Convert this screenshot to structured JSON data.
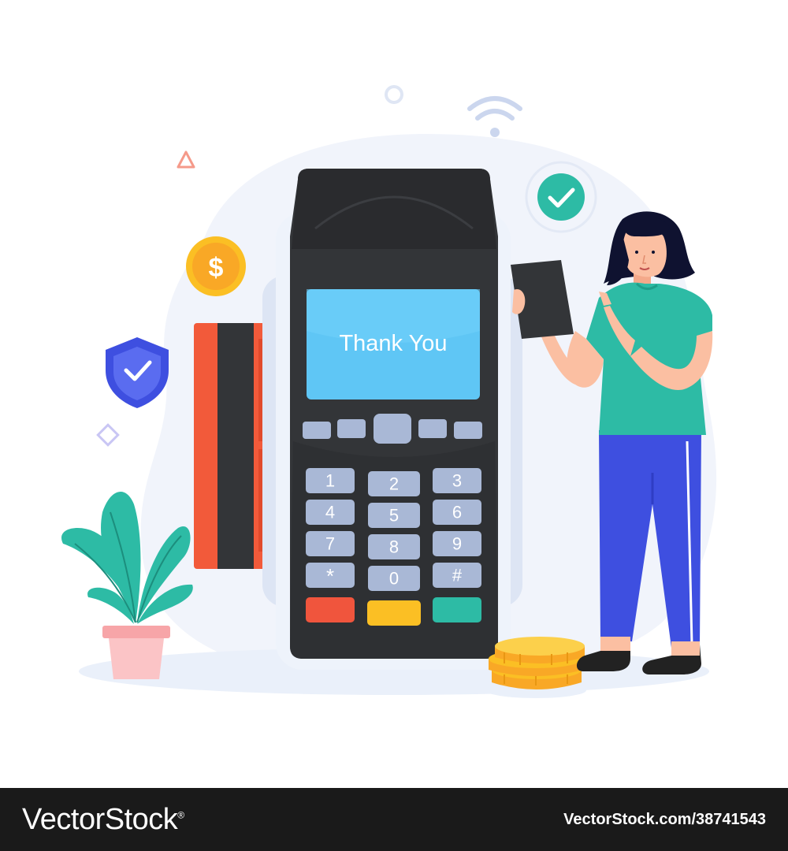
{
  "screen": {
    "message": "Thank You"
  },
  "keypad": {
    "keys": [
      "1",
      "2",
      "3",
      "4",
      "5",
      "6",
      "7",
      "8",
      "9",
      "*",
      "0",
      "#"
    ]
  },
  "coin_symbol": "$",
  "icons": {
    "wifi": "wifi-icon",
    "check_badge": "check-circle-icon",
    "shield": "shield-check-icon",
    "coin": "dollar-coin-icon"
  },
  "colors": {
    "terminal_body": "#333538",
    "screen": "#5fc6f5",
    "key": "#a9b8d6",
    "cancel_key": "#f0553d",
    "clear_key": "#fbbf24",
    "enter_key": "#2dbba5",
    "card": "#f25a3a",
    "shirt": "#2dbba5",
    "pants": "#3e4fe0",
    "coin": "#fbbf24"
  },
  "footer": {
    "brand": "VectorStock",
    "registered_mark": "®",
    "image_code": "VectorStock.com/38741543"
  }
}
